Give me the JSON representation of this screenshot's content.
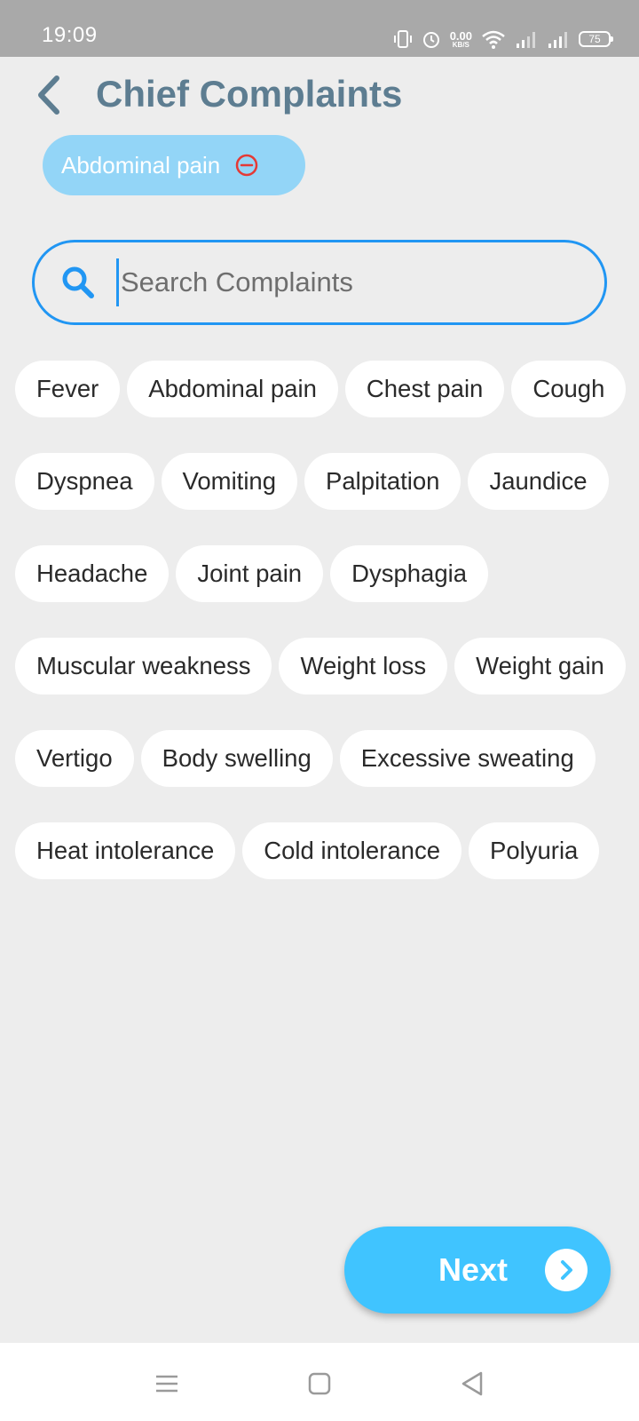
{
  "status_bar": {
    "time": "19:09",
    "net_speed": "0.00",
    "net_unit": "KB/S",
    "battery": "75",
    "icons": [
      "vibrate-icon",
      "alarm-icon",
      "wifi-icon",
      "signal-icon",
      "signal-icon",
      "battery-icon"
    ]
  },
  "header": {
    "title": "Chief Complaints",
    "back_icon": "chevron-left-icon"
  },
  "selected": [
    {
      "label": "Abdominal pain",
      "remove_icon": "minus-circle-icon"
    }
  ],
  "search": {
    "placeholder": "Search Complaints",
    "value": "",
    "icon": "search-icon"
  },
  "complaints": [
    "Fever",
    "Abdominal pain",
    "Chest pain",
    "Cough",
    "Dyspnea",
    "Vomiting",
    "Palpitation",
    "Jaundice",
    "Headache",
    "Joint pain",
    "Dysphagia",
    "Muscular weakness",
    "Weight loss",
    "Weight gain",
    "Vertigo",
    "Body swelling",
    "Excessive sweating",
    "Heat intolerance",
    "Cold intolerance",
    "Polyuria"
  ],
  "next_button": {
    "label": "Next",
    "icon": "chevron-right-icon"
  },
  "nav_bar": {
    "icons": [
      "menu-icon",
      "home-icon",
      "back-icon"
    ]
  },
  "colors": {
    "title": "#5d7d91",
    "accent": "#2196f3",
    "selected_chip": "#93d5f7",
    "remove": "#e53935",
    "next_button": "#40c4ff",
    "background": "#ededed"
  }
}
